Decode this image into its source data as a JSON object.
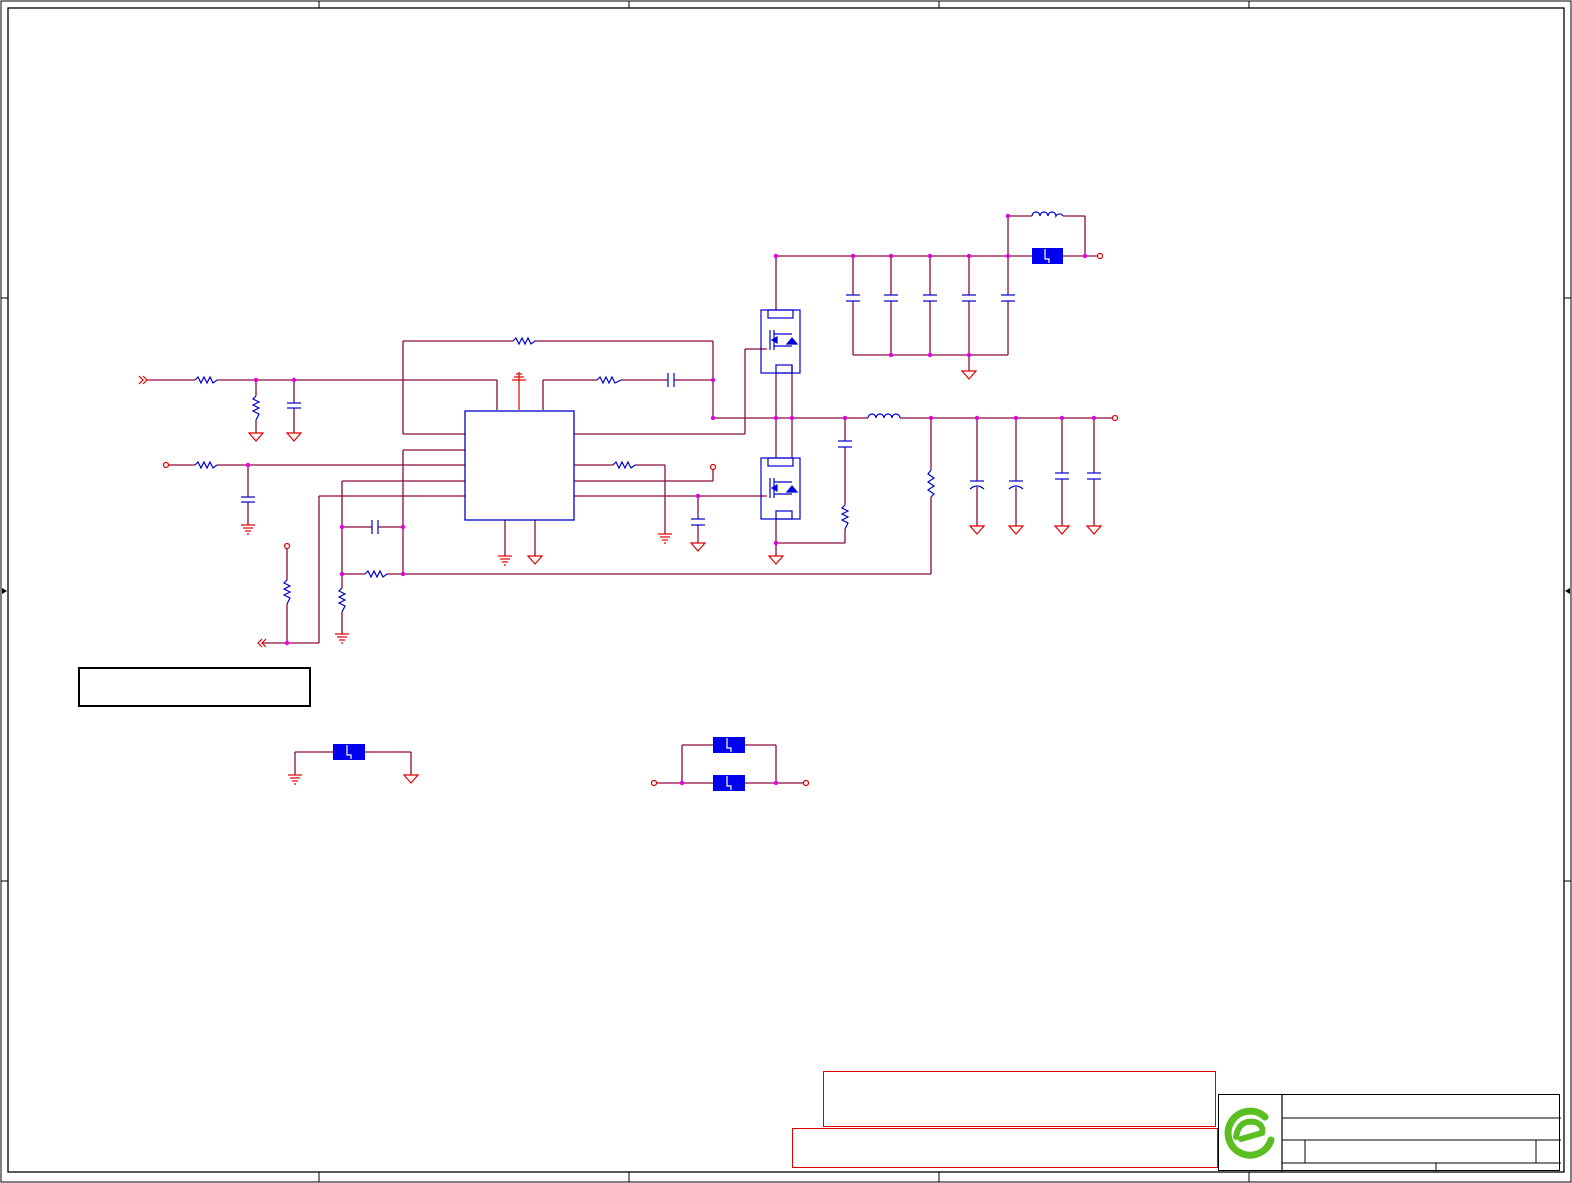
{
  "colors": {
    "wire": "#8b0a3d",
    "ground_symbol": "#e00000",
    "component": "#0000cc",
    "component_fill": "#0000ee",
    "junction": "#e000e0",
    "logo_green": "#5bbf21",
    "note_border": "#e00000"
  },
  "logo": {
    "icon": "company-logo-e-icon"
  }
}
